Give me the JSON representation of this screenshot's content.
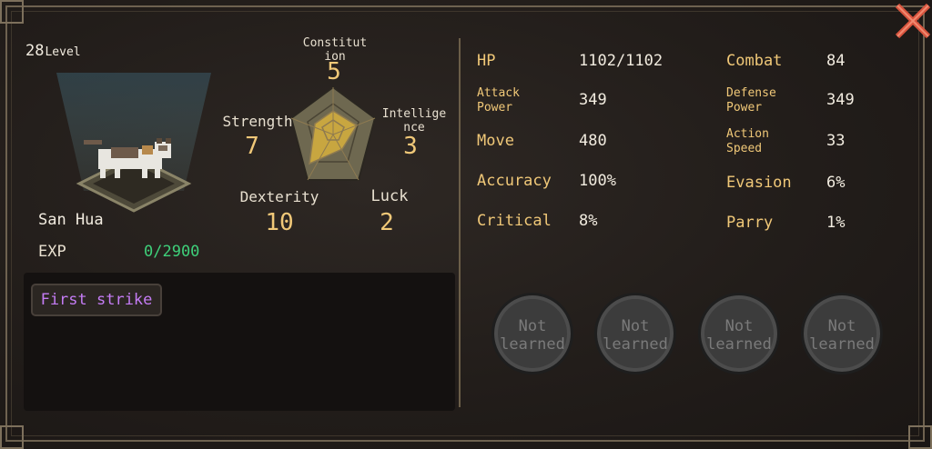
{
  "character": {
    "level_number": "28",
    "level_word": "Level",
    "name": "San Hua",
    "exp_label": "EXP",
    "exp_value": "0/2900"
  },
  "radar": {
    "constitution": {
      "label": "Constitut\nion",
      "value": "5"
    },
    "intelligence": {
      "label": "Intellige\nnce",
      "value": "3"
    },
    "strength": {
      "label": "Strength",
      "value": "7"
    },
    "dexterity": {
      "label": "Dexterity",
      "value": "10"
    },
    "luck": {
      "label": "Luck",
      "value": "2"
    },
    "colors": {
      "fill": "#c8a640",
      "grid": "#8e7a50"
    }
  },
  "skills": {
    "active": "First strike"
  },
  "stats": {
    "hp_label": "HP",
    "hp_value": "1102/1102",
    "combat_label": "Combat",
    "combat_value": "84",
    "attack_label": "Attack\nPower",
    "attack_value": "349",
    "defense_label": "Defense\nPower",
    "defense_value": "349",
    "move_label": "Move",
    "move_value": "480",
    "action_label": "Action\nSpeed",
    "action_value": "33",
    "accuracy_label": "Accuracy",
    "accuracy_value": "100%",
    "evasion_label": "Evasion",
    "evasion_value": "6%",
    "critical_label": "Critical",
    "critical_value": "8%",
    "parry_label": "Parry",
    "parry_value": "1%"
  },
  "slots": [
    "Not\nlearned",
    "Not\nlearned",
    "Not\nlearned",
    "Not\nlearned"
  ],
  "icons": {
    "close": "close-x-icon",
    "portrait": "cat-sprite-icon"
  },
  "colors": {
    "accent": "#f0c878",
    "exp": "#3ed07a",
    "skill": "#c47cf4",
    "close": "#d9543e"
  }
}
